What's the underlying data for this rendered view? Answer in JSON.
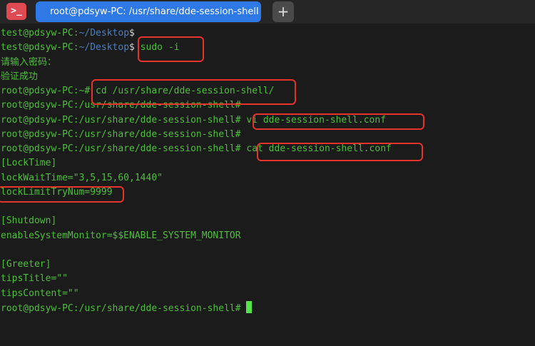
{
  "tabbar": {
    "app_icon_glyph": ">_",
    "app_icon_name": "terminal-app-icon",
    "tab_title": "root@pdsyw-PC: /usr/share/dde-session-shell",
    "add_tab_glyph": "+",
    "add_tab_icon_name": "plus-icon"
  },
  "colors": {
    "tab_active": "#2f79e6",
    "prompt_green": "#4dbf3a",
    "path_blue": "#4a7fc2",
    "highlight_red": "#e4332a",
    "cursor": "#55e24a",
    "background": "#1b1b1b"
  },
  "terminal": {
    "lines": [
      {
        "user": "test@pdsyw-PC",
        "sep": ":",
        "path": "~/Desktop",
        "dollar": "$",
        "cmd": ""
      },
      {
        "user": "test@pdsyw-PC",
        "sep": ":",
        "path": "~/Desktop",
        "dollar": "$",
        "cmd": " sudo -i"
      },
      {
        "out": "请输入密码："
      },
      {
        "out": "验证成功"
      },
      {
        "out": "root@pdsyw-PC:~# cd /usr/share/dde-session-shell/"
      },
      {
        "out": "root@pdsyw-PC:/usr/share/dde-session-shell#"
      },
      {
        "out": "root@pdsyw-PC:/usr/share/dde-session-shell# vi dde-session-shell.conf"
      },
      {
        "out": "root@pdsyw-PC:/usr/share/dde-session-shell#"
      },
      {
        "out": "root@pdsyw-PC:/usr/share/dde-session-shell# cat dde-session-shell.conf"
      },
      {
        "out": "[LockTime]"
      },
      {
        "out": "lockWaitTime=\"3,5,15,60,1440\""
      },
      {
        "out": "lockLimitTryNum=9999"
      },
      {
        "out": ""
      },
      {
        "out": "[Shutdown]"
      },
      {
        "out": "enableSystemMonitor=$$ENABLE_SYSTEM_MONITOR"
      },
      {
        "out": ""
      },
      {
        "out": "[Greeter]"
      },
      {
        "out": "tipsTitle=\"\""
      },
      {
        "out": "tipsContent=\"\""
      },
      {
        "out": "root@pdsyw-PC:/usr/share/dde-session-shell# "
      }
    ]
  }
}
